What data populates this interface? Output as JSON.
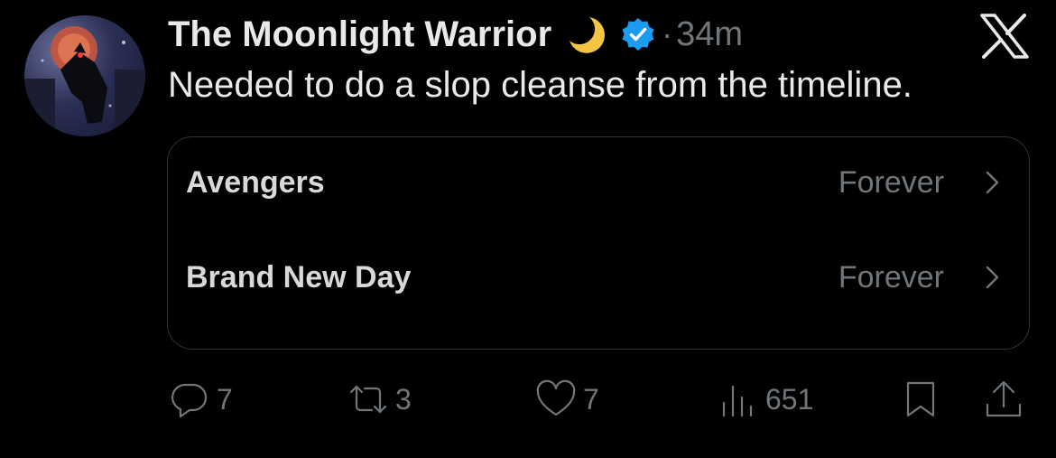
{
  "tweet": {
    "display_name": "The Moonlight Warrior",
    "separator": "·",
    "timestamp": "34m",
    "text": "Needed to do a slop cleanse from the timeline."
  },
  "poll_card": {
    "rows": [
      {
        "title": "Avengers",
        "meta": "Forever"
      },
      {
        "title": "Brand New Day",
        "meta": "Forever"
      }
    ]
  },
  "actions": {
    "replies": "7",
    "reposts": "3",
    "likes": "7",
    "views": "651"
  },
  "icons": {
    "avatar": "avatar-image",
    "moon": "crescent-moon-icon",
    "verified": "verified-badge-icon",
    "brand": "x-logo-icon",
    "chevron": "chevron-right-icon",
    "reply": "reply-icon",
    "repost": "repost-icon",
    "like": "heart-icon",
    "views": "analytics-icon",
    "bookmark": "bookmark-icon",
    "share": "share-icon"
  },
  "colors": {
    "background": "#000000",
    "text_primary": "#e7e9ea",
    "text_secondary": "#71767b",
    "border": "#2f3336",
    "verified": "#1d9bf0",
    "moon": "#f4c542"
  }
}
